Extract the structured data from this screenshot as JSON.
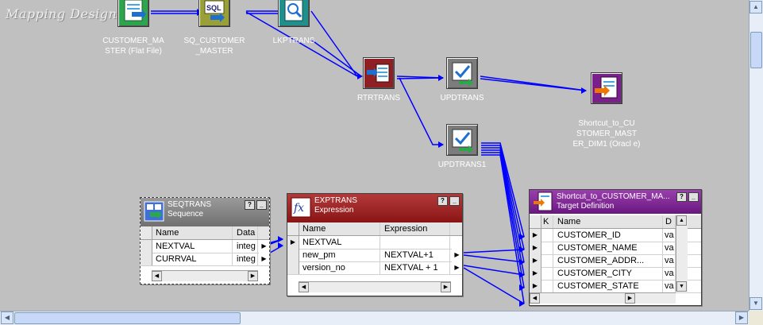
{
  "canvas": {
    "watermark": "Mapping Designer"
  },
  "nodes": {
    "source": {
      "label": "CUSTOMER_MA STER (Flat File)",
      "icon": "flat-file-source-icon"
    },
    "sq": {
      "label": "SQ_CUSTOMER _MASTER",
      "icon": "sql-icon"
    },
    "lookup": {
      "label": "LKPTRANS",
      "icon": "lookup-icon"
    },
    "router": {
      "label": "RTRTRANS",
      "icon": "router-icon"
    },
    "upd1": {
      "label": "UPDTRANS",
      "icon": "update-strategy-icon"
    },
    "upd2": {
      "label": "UPDTRANS1",
      "icon": "update-strategy-icon"
    },
    "target_top": {
      "label": "Shortcut_to_CU STOMER_MAST ER_DIM1 (Oracl e)",
      "icon": "target-icon"
    }
  },
  "seq": {
    "title": "SEQTRANS",
    "subtitle": "Sequence",
    "columns": [
      "Name",
      "Data"
    ],
    "rows": [
      [
        "NEXTVAL",
        "integ"
      ],
      [
        "CURRVAL",
        "integ"
      ]
    ]
  },
  "exp": {
    "title": "EXPTRANS",
    "subtitle": "Expression",
    "columns": [
      "Name",
      "Expression"
    ],
    "rows": [
      [
        "NEXTVAL",
        ""
      ],
      [
        "new_pm",
        "NEXTVAL+1"
      ],
      [
        "version_no",
        "NEXTVAL + 1"
      ]
    ]
  },
  "tgt": {
    "title": "Shortcut_to_CUSTOMER_MA...",
    "subtitle": "Target Definition",
    "columns": [
      "K",
      "Name",
      "D"
    ],
    "rows": [
      [
        "CUSTOMER_ID",
        "va"
      ],
      [
        "CUSTOMER_NAME",
        "va"
      ],
      [
        "CUSTOMER_ADDR...",
        "va"
      ],
      [
        "CUSTOMER_CITY",
        "va"
      ],
      [
        "CUSTOMER_STATE",
        "va"
      ]
    ]
  },
  "buttons": {
    "help": "?",
    "minimize": "_"
  },
  "colors": {
    "link": "#0000ff",
    "exp_header": "#9c1c1c",
    "seq_header": "#787878",
    "tgt_header": "#7a1f8c"
  }
}
